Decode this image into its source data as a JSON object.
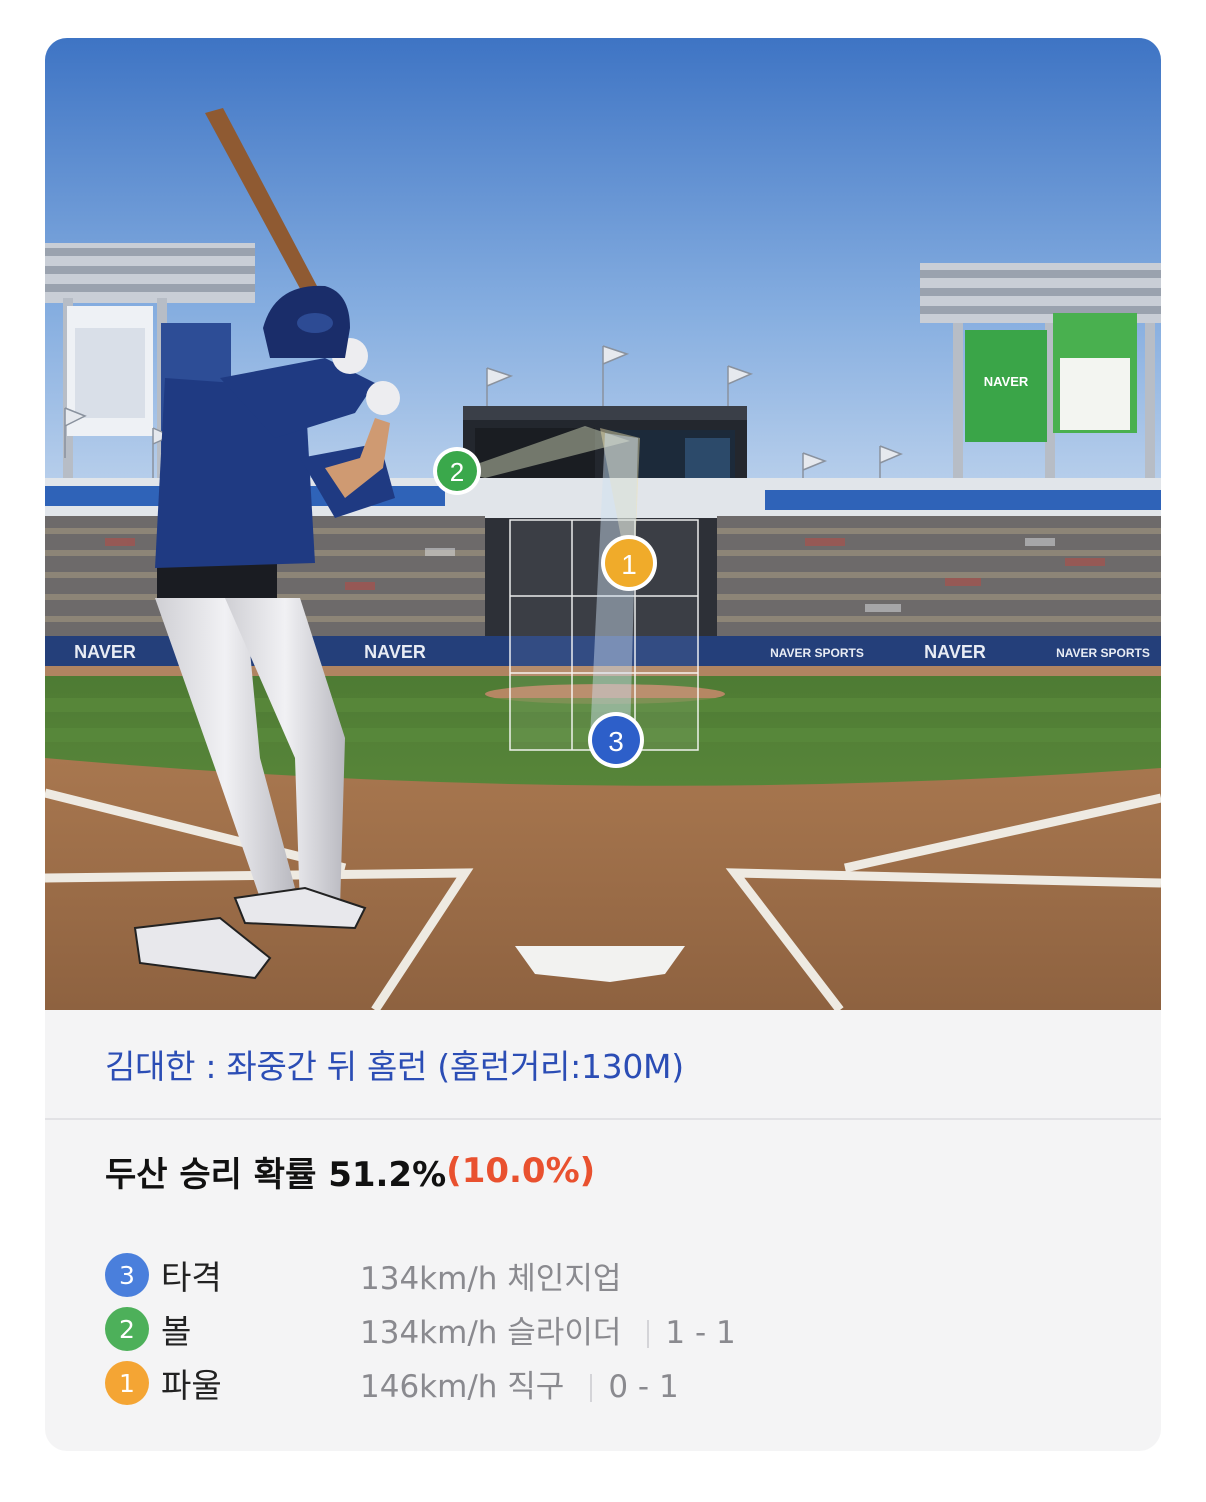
{
  "scene": {
    "naver_board_label": "NAVER",
    "fence_labels": [
      "NAVER",
      "NAVER",
      "NAVER SPORTS",
      "NAVER",
      "NAVER SPORTS"
    ],
    "markers": [
      {
        "number": "2",
        "color": "#3aa84b"
      },
      {
        "number": "1",
        "color": "#f0ab2a"
      },
      {
        "number": "3",
        "color": "#2d5fc9"
      }
    ]
  },
  "caption": "김대한 : 좌중간 뒤 홈런 (홈런거리:130M)",
  "win_prob": {
    "label": "두산 승리 확률 51.2%",
    "delta": "(10.0%)"
  },
  "pitches": [
    {
      "num": "3",
      "color": "#4a7fdc",
      "result": "타격",
      "speed": "134km/h",
      "type": "체인지업",
      "count": ""
    },
    {
      "num": "2",
      "color": "#4db05a",
      "result": "볼",
      "speed": "134km/h",
      "type": "슬라이더",
      "count": "1 - 1"
    },
    {
      "num": "1",
      "color": "#f4a534",
      "result": "파울",
      "speed": "146km/h",
      "type": "직구",
      "count": "0 - 1"
    }
  ]
}
